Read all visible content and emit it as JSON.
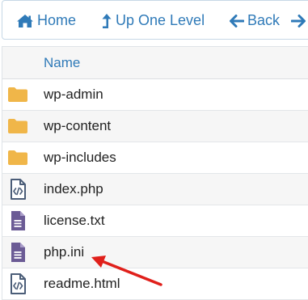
{
  "toolbar": {
    "home_label": "Home",
    "up_label": "Up One Level",
    "back_label": "Back",
    "accent_color": "#2f7ab8"
  },
  "table": {
    "column_name": "Name",
    "rows": [
      {
        "name": "wp-admin",
        "icon": "folder-icon"
      },
      {
        "name": "wp-content",
        "icon": "folder-icon"
      },
      {
        "name": "wp-includes",
        "icon": "folder-icon"
      },
      {
        "name": "index.php",
        "icon": "code-file-icon"
      },
      {
        "name": "license.txt",
        "icon": "text-file-icon"
      },
      {
        "name": "php.ini",
        "icon": "text-file-icon"
      },
      {
        "name": "readme.html",
        "icon": "code-file-icon"
      }
    ]
  },
  "colors": {
    "folder": "#f0b649",
    "file_purple": "#6b5b95",
    "arrow_red": "#e0201b"
  }
}
